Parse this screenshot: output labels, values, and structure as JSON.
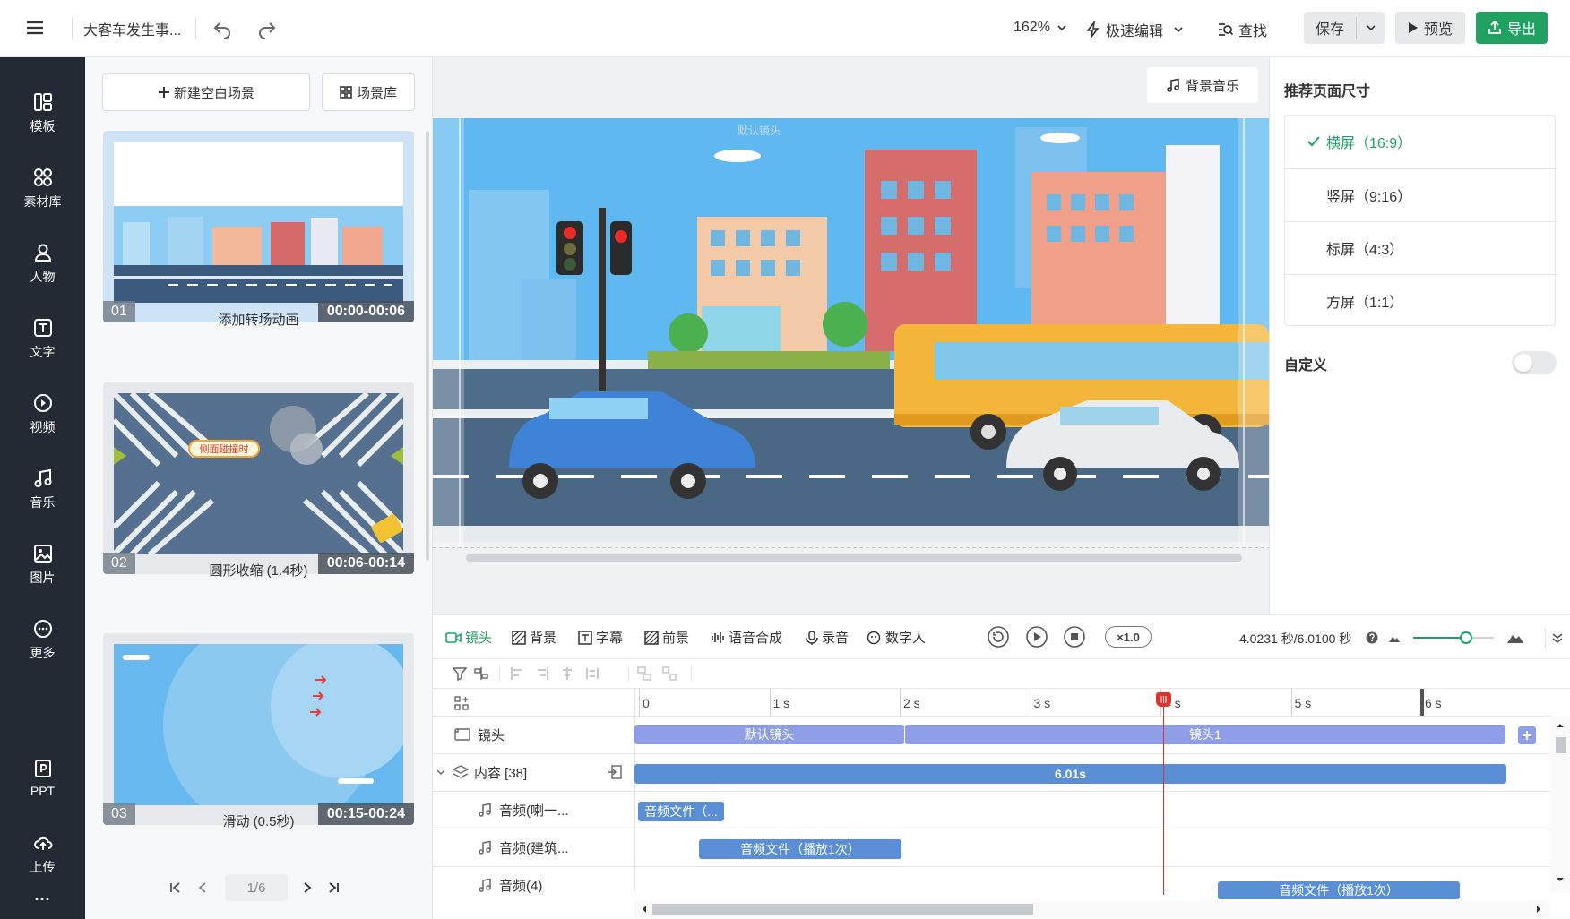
{
  "topbar": {
    "menu_icon": "hamburger-icon",
    "title": "大客车发生事...",
    "zoom": "162%",
    "mode": "极速编辑",
    "find": "查找",
    "save": "保存",
    "preview": "预览",
    "export": "导出"
  },
  "sidebar": {
    "items": [
      {
        "label": "模板",
        "icon": "template-icon"
      },
      {
        "label": "素材库",
        "icon": "assets-icon"
      },
      {
        "label": "人物",
        "icon": "person-icon"
      },
      {
        "label": "文字",
        "icon": "text-icon"
      },
      {
        "label": "视频",
        "icon": "video-icon"
      },
      {
        "label": "音乐",
        "icon": "music-icon"
      },
      {
        "label": "图片",
        "icon": "image-icon"
      },
      {
        "label": "更多",
        "icon": "more-icon"
      }
    ],
    "ppt": "PPT",
    "upload": "上传",
    "dots": "···"
  },
  "scenes": {
    "new_scene": "新建空白场景",
    "library": "场景库",
    "cards": [
      {
        "index": "01",
        "time": "00:00-00:06",
        "caption": "添加转场动画"
      },
      {
        "index": "02",
        "time": "00:06-00:14",
        "caption": "圆形收缩 (1.4秒)",
        "badge": "侧面碰撞时"
      },
      {
        "index": "03",
        "time": "00:15-00:24",
        "caption": "滑动 (0.5秒)"
      }
    ],
    "pager": "1/6"
  },
  "canvas": {
    "bg_music": "背景音乐",
    "camera_label": "默认镜头"
  },
  "right_panel": {
    "title": "推荐页面尺寸",
    "options": [
      {
        "label": "横屏（16:9）",
        "selected": true
      },
      {
        "label": "竖屏（9:16）",
        "selected": false
      },
      {
        "label": "标屏（4:3）",
        "selected": false
      },
      {
        "label": "方屏（1:1）",
        "selected": false
      }
    ],
    "custom": "自定义",
    "custom_enabled": false
  },
  "timeline": {
    "tabs": [
      "镜头",
      "背景",
      "字幕",
      "前景",
      "语音合成",
      "录音",
      "数字人"
    ],
    "speed": "×1.0",
    "time_readout": "4.0231 秒/6.0100 秒",
    "ruler": [
      "0",
      "1 s",
      "2 s",
      "3 s",
      "4 s",
      "5 s",
      "6 s"
    ],
    "playhead_seconds": 4.0231,
    "total_seconds": 6.01,
    "tracks": {
      "camera": "镜头",
      "content": "内容 [38]",
      "audio1": "音频(喇一...",
      "audio2": "音频(建筑...",
      "audio3": "音频(4)"
    },
    "clips": {
      "cam1": "默认镜头",
      "cam2": "镜头1",
      "content": "6.01s",
      "a1": "音频文件（...",
      "a2": "音频文件（播放1次）",
      "a3": "音频文件（播放1次）"
    }
  },
  "colors": {
    "accent": "#20a162",
    "clip_blue": "#5a8fd6",
    "camera_clip": "#8f9ee8",
    "playhead": "#e0312f",
    "sidebar_bg": "#232a33"
  }
}
